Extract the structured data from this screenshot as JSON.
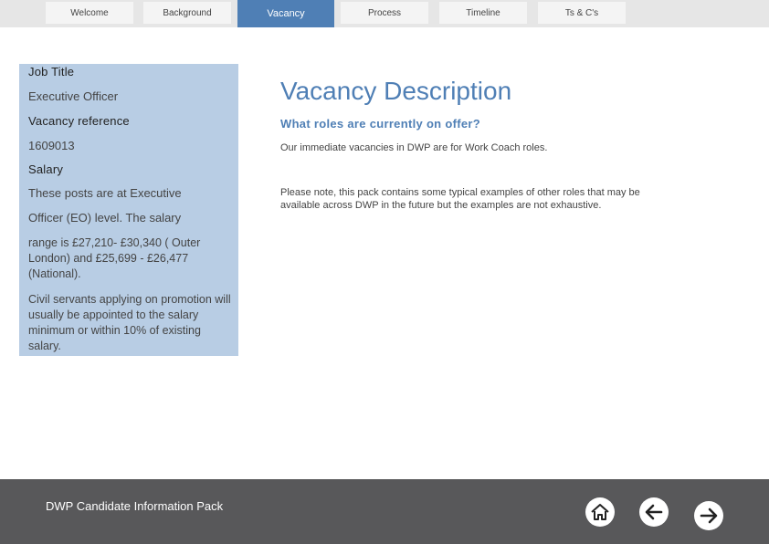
{
  "tabs": [
    {
      "label": "Welcome"
    },
    {
      "label": "Background"
    },
    {
      "label": "Vacancy"
    },
    {
      "label": "Process"
    },
    {
      "label": "Timeline"
    },
    {
      "label": "Ts & C's"
    }
  ],
  "sidebar": {
    "job_title_heading": "Job Title",
    "job_title_value": "Executive Officer",
    "vacancy_ref_heading": "Vacancy reference",
    "vacancy_ref_value": "1609013",
    "salary_heading": "Salary",
    "salary_line1": "These posts are at Executive",
    "salary_line2": "Officer (EO) level. The salary",
    "salary_line3": "range is £27,210- £30,340 ( Outer London) and £25,699 - £26,477 (National).",
    "promotion_text": "Civil servants applying on promotion will usually be appointed to the salary minimum or within 10% of existing salary."
  },
  "main": {
    "title": "Vacancy Description",
    "subheading": "What roles are currently on offer?",
    "paragraph1": "Our immediate vacancies in DWP are for Work Coach roles.",
    "paragraph2": "Please note, this pack contains some typical examples of other roles that may be available across DWP in the future but the examples are not exhaustive."
  },
  "footer": {
    "title": "DWP Candidate Information Pack",
    "home_icon": "home-icon",
    "back_icon": "arrow-left-icon",
    "next_icon": "arrow-right-icon"
  },
  "colors": {
    "accent": "#4f7fb5",
    "sidebar_bg": "#b8cde4",
    "footer_bg": "#58585a",
    "tab_bg": "#f4f4f4",
    "topbar_bg": "#e6e6e6"
  }
}
